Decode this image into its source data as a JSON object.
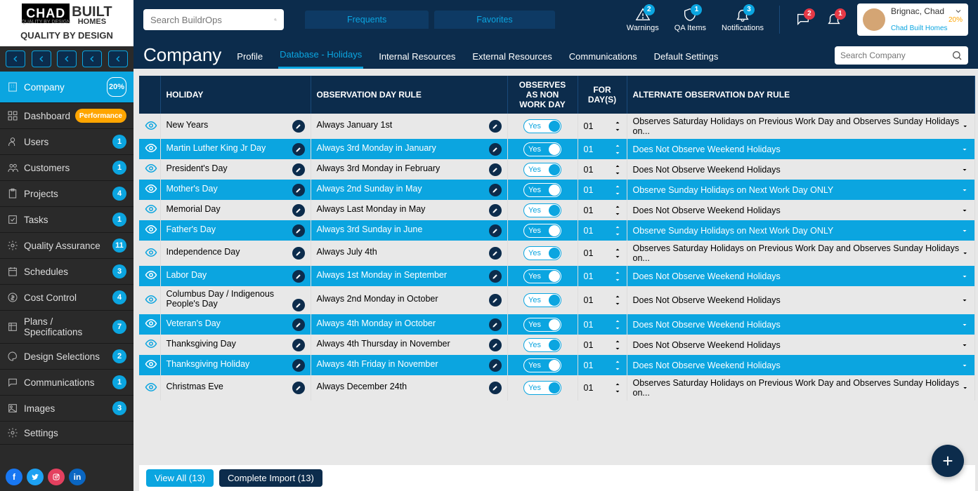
{
  "logo": {
    "brand1": "CHAD",
    "brand2": "BUILT",
    "brand3": "HOMES",
    "subtitle": "QUALITY BY DESIGN",
    "tagline": "QUALITY BY DESIGN"
  },
  "search": {
    "placeholder": "Search BuildrOps"
  },
  "topTabs": {
    "frequents": "Frequents",
    "favorites": "Favorites"
  },
  "topIcons": {
    "warnings": {
      "label": "Warnings",
      "count": "2"
    },
    "qa": {
      "label": "QA Items",
      "count": "1"
    },
    "notifications": {
      "label": "Notifications",
      "count": "3"
    },
    "msg": {
      "count": "2"
    },
    "bell": {
      "count": "1"
    }
  },
  "user": {
    "name": "Brignac, Chad",
    "percent": "20%",
    "company": "Chad Built Homes"
  },
  "page": {
    "title": "Company",
    "searchPlaceholder": "Search Company"
  },
  "subTabs": {
    "profile": "Profile",
    "database": "Database - Holidays",
    "internal": "Internal Resources",
    "external": "External Resources",
    "communications": "Communications",
    "defaults": "Default Settings"
  },
  "sidebar": {
    "company": {
      "label": "Company",
      "pct": "20%"
    },
    "dashboard": {
      "label": "Dashboard",
      "badge": "Performance"
    },
    "users": {
      "label": "Users",
      "count": "1"
    },
    "customers": {
      "label": "Customers",
      "count": "1"
    },
    "projects": {
      "label": "Projects",
      "count": "4"
    },
    "tasks": {
      "label": "Tasks",
      "count": "1"
    },
    "qa": {
      "label": "Quality Assurance",
      "count": "11"
    },
    "schedules": {
      "label": "Schedules",
      "count": "3"
    },
    "cost": {
      "label": "Cost Control",
      "count": "4"
    },
    "plans": {
      "label": "Plans / Specifications",
      "count": "7"
    },
    "design": {
      "label": "Design Selections",
      "count": "2"
    },
    "comm": {
      "label": "Communications",
      "count": "1"
    },
    "images": {
      "label": "Images",
      "count": "3"
    },
    "settings": {
      "label": "Settings"
    }
  },
  "table": {
    "headers": {
      "holiday": "HOLIDAY",
      "rule": "OBSERVATION DAY RULE",
      "observes": "OBSERVES AS NON WORK DAY",
      "days": "FOR DAY(S)",
      "alt": "ALTERNATE OBSERVATION DAY RULE"
    },
    "rows": [
      {
        "holiday": "New Years",
        "rule": "Always January 1st",
        "obs": "Yes",
        "days": "01",
        "alt": "Observes Saturday Holidays on Previous Work Day and Observes Sunday Holidays on..."
      },
      {
        "holiday": "Martin Luther King Jr Day",
        "rule": "Always 3rd Monday in January",
        "obs": "Yes",
        "days": "01",
        "alt": "Does Not Observe Weekend Holidays"
      },
      {
        "holiday": "President's Day",
        "rule": "Always 3rd Monday in February",
        "obs": "Yes",
        "days": "01",
        "alt": "Does Not Observe Weekend Holidays"
      },
      {
        "holiday": "Mother's Day",
        "rule": "Always 2nd Sunday in May",
        "obs": "Yes",
        "days": "01",
        "alt": "Observe Sunday Holidays on Next Work Day ONLY"
      },
      {
        "holiday": "Memorial Day",
        "rule": "Always Last Monday in May",
        "obs": "Yes",
        "days": "01",
        "alt": "Does Not Observe Weekend Holidays"
      },
      {
        "holiday": "Father's Day",
        "rule": "Always 3rd Sunday in June",
        "obs": "Yes",
        "days": "01",
        "alt": "Observe Sunday Holidays on Next Work Day ONLY"
      },
      {
        "holiday": "Independence Day",
        "rule": "Always July 4th",
        "obs": "Yes",
        "days": "01",
        "alt": "Observes Saturday Holidays on Previous Work Day and Observes Sunday Holidays on..."
      },
      {
        "holiday": "Labor Day",
        "rule": "Always 1st Monday in September",
        "obs": "Yes",
        "days": "01",
        "alt": "Does Not Observe Weekend Holidays"
      },
      {
        "holiday": "Columbus Day / Indigenous People's Day",
        "rule": "Always 2nd Monday in October",
        "obs": "Yes",
        "days": "01",
        "alt": "Does Not Observe Weekend Holidays"
      },
      {
        "holiday": "Veteran's Day",
        "rule": "Always 4th Monday in October",
        "obs": "Yes",
        "days": "01",
        "alt": "Does Not Observe Weekend Holidays"
      },
      {
        "holiday": "Thanksgiving Day",
        "rule": "Always 4th Thursday in November",
        "obs": "Yes",
        "days": "01",
        "alt": "Does Not Observe Weekend Holidays"
      },
      {
        "holiday": "Thanksgiving Holiday",
        "rule": "Always 4th Friday in November",
        "obs": "Yes",
        "days": "01",
        "alt": "Does Not Observe Weekend Holidays"
      },
      {
        "holiday": "Christmas Eve",
        "rule": "Always December 24th",
        "obs": "Yes",
        "days": "01",
        "alt": "Observes Saturday Holidays on Previous Work Day and Observes Sunday Holidays on..."
      }
    ]
  },
  "footer": {
    "viewAll": "View All (13)",
    "import": "Complete Import  (13)"
  }
}
